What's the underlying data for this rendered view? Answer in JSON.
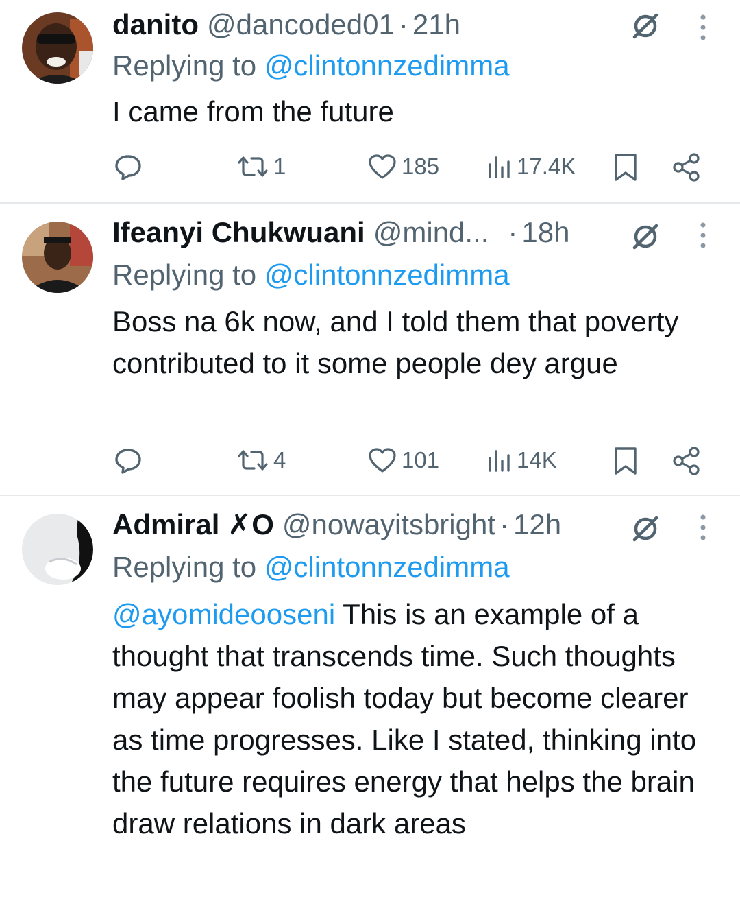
{
  "tweets": [
    {
      "name": "danito",
      "handle": "@dancoded01",
      "dot": "·",
      "time": "21h",
      "reply_prefix": "Replying to",
      "reply_to": "@clintonnzedimma",
      "body_mention": "",
      "body": "I came from the future",
      "retweets": "1",
      "likes": "185",
      "views": "17.4K"
    },
    {
      "name": "Ifeanyi Chukwuani",
      "handle": "@mind...",
      "dot": "·",
      "time": "18h",
      "reply_prefix": "Replying to",
      "reply_to": "@clintonnzedimma",
      "body_mention": "",
      "body": "Boss na 6k now, and I told them that poverty contributed to it some people dey argue",
      "retweets": "4",
      "likes": "101",
      "views": "14K"
    },
    {
      "name": "Admiral ✗O",
      "handle": "@nowayitsbright",
      "dot": "·",
      "time": "12h",
      "reply_prefix": "Replying to",
      "reply_to": "@clintonnzedimma",
      "body_mention": "@ayomideooseni",
      "body": " This is an example of a thought that transcends time. Such thoughts may appear foolish today but become clearer as time progresses. Like I stated, thinking  into the future requires energy that helps the brain draw relations in dark areas",
      "retweets": "",
      "likes": "",
      "views": ""
    }
  ],
  "icons": {
    "reply": "reply-icon",
    "retweet": "retweet-icon",
    "like": "heart-icon",
    "views": "views-icon",
    "bookmark": "bookmark-icon",
    "share": "share-icon",
    "grok": "grok-icon",
    "more": "more-icon"
  },
  "colors": {
    "link": "#1d9bf0",
    "muted": "#536471",
    "text": "#0f1419",
    "divider": "#e6e9ec"
  }
}
